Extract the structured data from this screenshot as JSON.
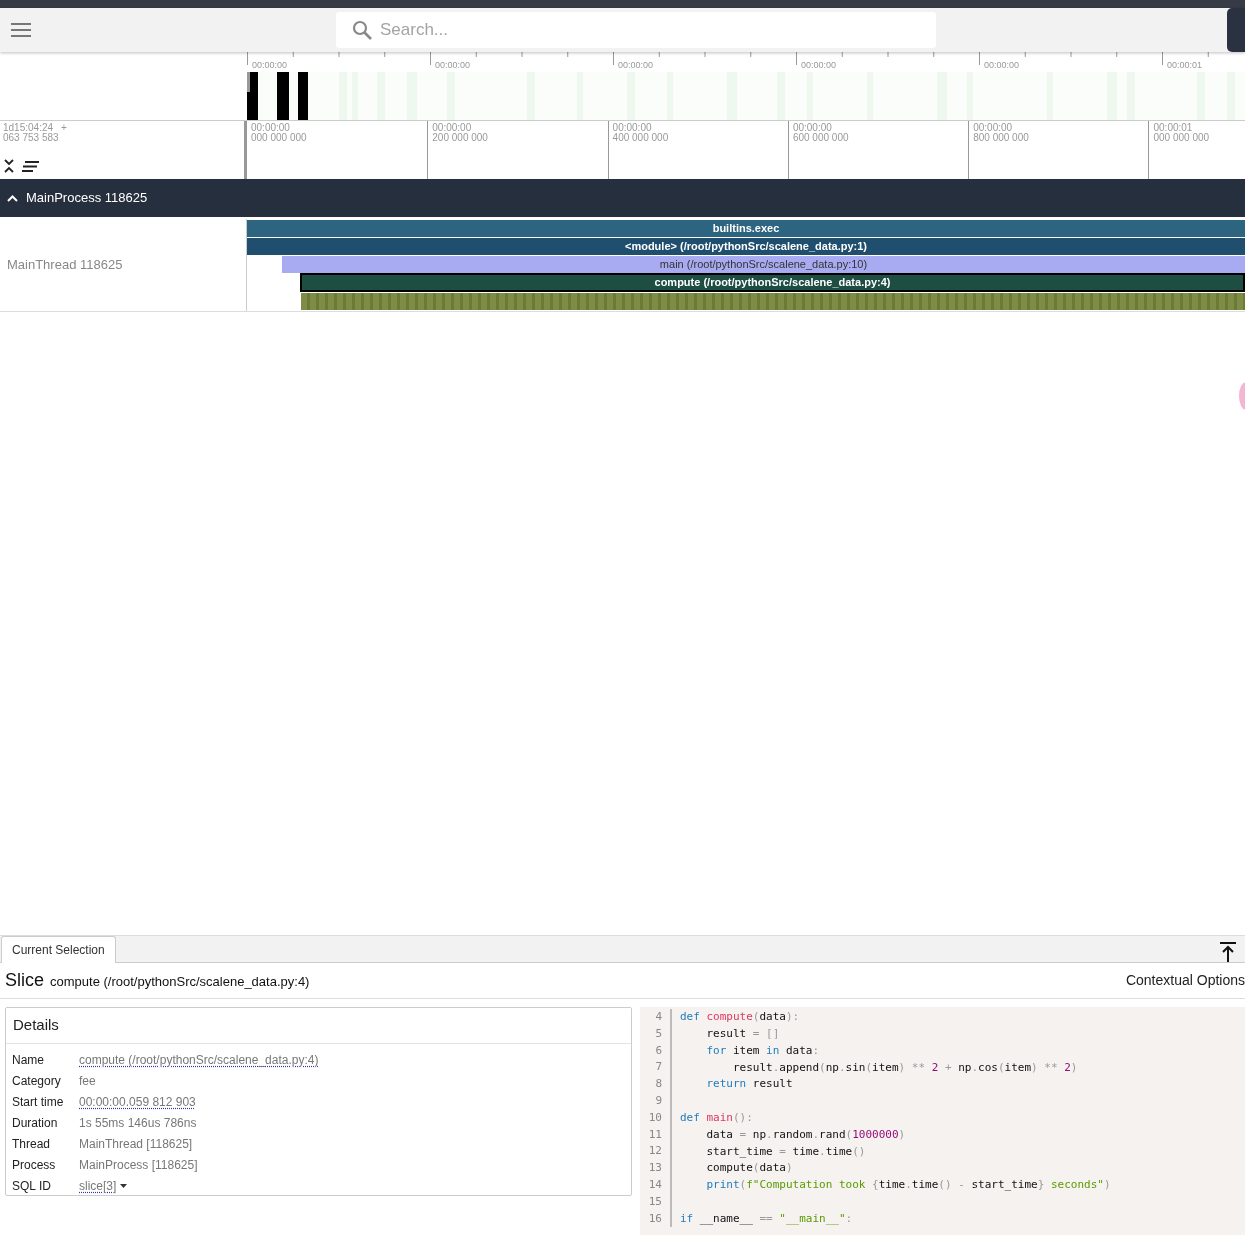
{
  "toolbar": {
    "search": {
      "placeholder": "Search..."
    }
  },
  "overview": {
    "ticks": [
      "00:00:00",
      "00:00:00",
      "00:00:00",
      "00:00:00",
      "00:00:00",
      "00:00:01"
    ]
  },
  "time_axis": {
    "origin_time": "1d15:04:24",
    "origin_sign": "+",
    "origin_offset": "063 753 583",
    "ticks": [
      {
        "time": "00:00:00",
        "offset": "000 000 000"
      },
      {
        "time": "00:00:00",
        "offset": "200 000 000"
      },
      {
        "time": "00:00:00",
        "offset": "400 000 000"
      },
      {
        "time": "00:00:00",
        "offset": "600 000 000"
      },
      {
        "time": "00:00:00",
        "offset": "800 000 000"
      },
      {
        "time": "00:00:01",
        "offset": "000 000 000"
      }
    ]
  },
  "process": {
    "name": "MainProcess 118625",
    "expanded": true
  },
  "thread": {
    "name": "MainThread 118625",
    "slices": [
      {
        "label": "builtins.exec",
        "color": "#2d6480",
        "selected": false
      },
      {
        "label": "<module> (/root/pythonSrc/scalene_data.py:1)",
        "color": "#1f4e6e",
        "selected": false
      },
      {
        "label": "main (/root/pythonSrc/scalene_data.py:10)",
        "color": "#a9abf2",
        "selected": false
      },
      {
        "label": "compute (/root/pythonSrc/scalene_data.py:4)",
        "color": "#1e4d42",
        "selected": true
      }
    ]
  },
  "bottom_panel": {
    "tabs": [
      {
        "label": "Current Selection",
        "selected": true
      }
    ],
    "title": "Slice",
    "subtitle": "compute (/root/pythonSrc/scalene_data.py:4)",
    "contextual": "Contextual Options",
    "details": {
      "heading": "Details",
      "rows": [
        {
          "label": "Name",
          "value": "compute (/root/pythonSrc/scalene_data.py:4)",
          "kind": "link"
        },
        {
          "label": "Category",
          "value": "fee",
          "kind": "text"
        },
        {
          "label": "Start time",
          "value": "00:00:00.059 812 903",
          "kind": "link"
        },
        {
          "label": "Duration",
          "value": "1s 55ms 146us 786ns",
          "kind": "text"
        },
        {
          "label": "Thread",
          "value": "MainThread [118625]",
          "kind": "text"
        },
        {
          "label": "Process",
          "value": "MainProcess [118625]",
          "kind": "text"
        },
        {
          "label": "SQL ID",
          "value": "slice[3]",
          "kind": "menu"
        }
      ]
    },
    "source": {
      "lines": [
        {
          "number": "4",
          "tokens": [
            {
              "text": "def ",
              "kind": "keyword"
            },
            {
              "text": "compute",
              "kind": "function"
            },
            {
              "text": "(",
              "kind": "punct"
            },
            {
              "text": "data",
              "kind": "name"
            },
            {
              "text": "):",
              "kind": "punct"
            }
          ]
        },
        {
          "number": "5",
          "tokens": [
            {
              "text": "    result",
              "kind": "name"
            },
            {
              "text": " = []",
              "kind": "punct"
            }
          ]
        },
        {
          "number": "6",
          "tokens": [
            {
              "text": "    for",
              "kind": "keyword"
            },
            {
              "text": " item ",
              "kind": "name"
            },
            {
              "text": "in",
              "kind": "keyword"
            },
            {
              "text": " data",
              "kind": "name"
            },
            {
              "text": ":",
              "kind": "punct"
            }
          ]
        },
        {
          "number": "7",
          "tokens": [
            {
              "text": "        result",
              "kind": "name"
            },
            {
              "text": ".",
              "kind": "punct"
            },
            {
              "text": "append",
              "kind": "name"
            },
            {
              "text": "(",
              "kind": "punct"
            },
            {
              "text": "np",
              "kind": "name"
            },
            {
              "text": ".",
              "kind": "punct"
            },
            {
              "text": "sin",
              "kind": "name"
            },
            {
              "text": "(",
              "kind": "punct"
            },
            {
              "text": "item",
              "kind": "name"
            },
            {
              "text": ")",
              "kind": "punct"
            },
            {
              "text": " ** ",
              "kind": "punct"
            },
            {
              "text": "2",
              "kind": "number"
            },
            {
              "text": " + ",
              "kind": "punct"
            },
            {
              "text": "np",
              "kind": "name"
            },
            {
              "text": ".",
              "kind": "punct"
            },
            {
              "text": "cos",
              "kind": "name"
            },
            {
              "text": "(",
              "kind": "punct"
            },
            {
              "text": "item",
              "kind": "name"
            },
            {
              "text": ")",
              "kind": "punct"
            },
            {
              "text": " ** ",
              "kind": "punct"
            },
            {
              "text": "2",
              "kind": "number"
            },
            {
              "text": ")",
              "kind": "punct"
            }
          ]
        },
        {
          "number": "8",
          "tokens": [
            {
              "text": "    return",
              "kind": "keyword"
            },
            {
              "text": " result",
              "kind": "name"
            }
          ]
        },
        {
          "number": "9"
        },
        {
          "number": "10",
          "tokens": [
            {
              "text": "def ",
              "kind": "keyword"
            },
            {
              "text": "main",
              "kind": "function"
            },
            {
              "text": "():",
              "kind": "punct"
            }
          ]
        },
        {
          "number": "11",
          "tokens": [
            {
              "text": "    data",
              "kind": "name"
            },
            {
              "text": " = ",
              "kind": "punct"
            },
            {
              "text": "np",
              "kind": "name"
            },
            {
              "text": ".",
              "kind": "punct"
            },
            {
              "text": "random",
              "kind": "name"
            },
            {
              "text": ".",
              "kind": "punct"
            },
            {
              "text": "rand",
              "kind": "name"
            },
            {
              "text": "(",
              "kind": "punct"
            },
            {
              "text": "1000000",
              "kind": "number"
            },
            {
              "text": ")",
              "kind": "punct"
            }
          ]
        },
        {
          "number": "12",
          "tokens": [
            {
              "text": "    start_time",
              "kind": "name"
            },
            {
              "text": " = ",
              "kind": "punct"
            },
            {
              "text": "time",
              "kind": "name"
            },
            {
              "text": ".",
              "kind": "punct"
            },
            {
              "text": "time",
              "kind": "name"
            },
            {
              "text": "()",
              "kind": "punct"
            }
          ]
        },
        {
          "number": "13",
          "tokens": [
            {
              "text": "    compute",
              "kind": "name"
            },
            {
              "text": "(",
              "kind": "punct"
            },
            {
              "text": "data",
              "kind": "name"
            },
            {
              "text": ")",
              "kind": "punct"
            }
          ]
        },
        {
          "number": "14",
          "tokens": [
            {
              "text": "    print",
              "kind": "keyword"
            },
            {
              "text": "(",
              "kind": "punct"
            },
            {
              "text": "f\"Computation took ",
              "kind": "string"
            },
            {
              "text": "{",
              "kind": "punct"
            },
            {
              "text": "time",
              "kind": "name"
            },
            {
              "text": ".",
              "kind": "punct"
            },
            {
              "text": "time",
              "kind": "name"
            },
            {
              "text": "()",
              "kind": "punct"
            },
            {
              "text": " - ",
              "kind": "punct"
            },
            {
              "text": "start_time",
              "kind": "name"
            },
            {
              "text": "}",
              "kind": "punct"
            },
            {
              "text": " seconds\"",
              "kind": "string"
            },
            {
              "text": ")",
              "kind": "punct"
            }
          ]
        },
        {
          "number": "15"
        },
        {
          "number": "16",
          "tokens": [
            {
              "text": "if",
              "kind": "keyword"
            },
            {
              "text": " __name__ ",
              "kind": "name"
            },
            {
              "text": "==",
              "kind": "punct"
            },
            {
              "text": " \"__main__\"",
              "kind": "string"
            },
            {
              "text": ":",
              "kind": "punct"
            }
          ]
        }
      ]
    }
  }
}
